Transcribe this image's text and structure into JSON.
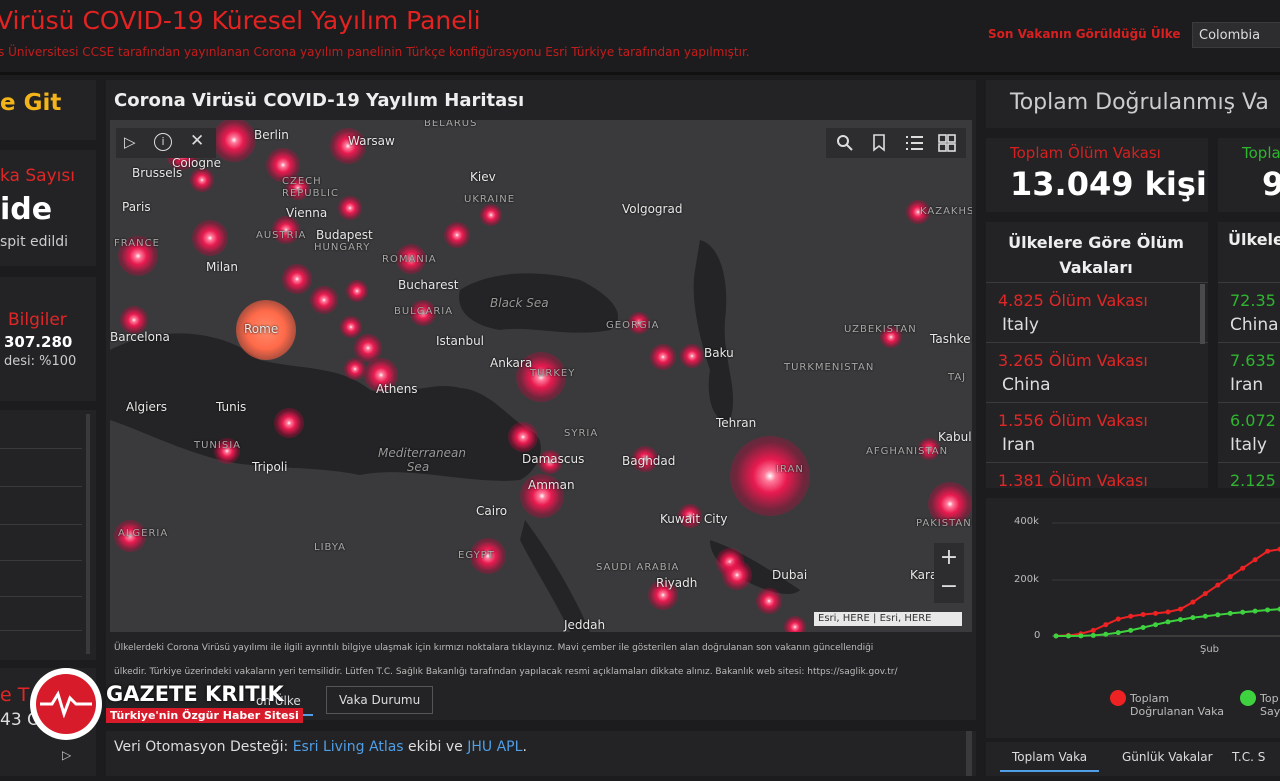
{
  "header": {
    "title": "Virüsü COVID-19 Küresel Yayılım Paneli",
    "subtitle": "s Üniversitesi CCSE tarafından yayınlanan Corona yayılım panelinin Türkçe konfigürasyonu Esri Türkiye tarafından yapılmıştır.",
    "last_case_label": "Son Vakanın Görüldüğü Ülke",
    "last_case_country": "Colombia"
  },
  "left": {
    "goto_label": "e Git",
    "case_count_label": "ka Sayısı",
    "case_count_value": "ide",
    "case_count_note": "spit edildi",
    "info_label": "Bilgiler",
    "info_value": "307.280",
    "info_note": "desi: %100",
    "bottom_label": "e T",
    "bottom_value": "43 O"
  },
  "map": {
    "title": "Corona Virüsü COVID-19 Yayılım Haritası",
    "attribution": "Esri, HERE | Esri, HERE",
    "note_line1": "Ülkelerdeki Corona Virüsü yayılımı ile ilgili ayrıntılı bilgiye ulaşmak için kırmızı noktalara tıklayınız. Mavi çember ile gösterilen alan doğrulanan son vakanın güncellendiği",
    "note_line2": "ülkedir. Türkiye üzerindeki vakaların yeri temsilidir. Lütfen T.C. Sağlık Bakanlığı tarafından yapılacak resmi açıklamaları dikkate alınız. Bakanlık web sitesi: https://saglik.gov.tr/",
    "labels": {
      "berlin": "Berlin",
      "warsaw": "Warsaw",
      "belarus": "BELARUS",
      "cologne": "Cologne",
      "brussels": "Brussels",
      "czech": "CZECH REPUBLIC",
      "kiev": "Kiev",
      "ukraine": "UKRAINE",
      "paris": "Paris",
      "vienna": "Vienna",
      "budapest": "Budapest",
      "hungary": "HUNGARY",
      "austria": "AUSTRIA",
      "france": "FRANCE",
      "volgograd": "Volgograd",
      "kazakhstan": "KAZAKHS",
      "romania": "ROMANIA",
      "milan": "Milan",
      "bucharest": "Bucharest",
      "bulgaria": "BULGARIA",
      "blacksea": "Black Sea",
      "barcelona": "Barcelona",
      "rome": "Rome",
      "georgia": "GEORGIA",
      "uzbekistan": "UZBEKISTAN",
      "tashkent": "Tashke",
      "istanbul": "Istanbul",
      "baku": "Baku",
      "ankara": "Ankara",
      "turkey": "TURKEY",
      "turkmenistan": "TURKMENISTAN",
      "athens": "Athens",
      "algiers": "Algiers",
      "tunis": "Tunis",
      "taj": "TAJ",
      "tunisia": "TUNISIA",
      "tehran": "Tehran",
      "syria": "SYRIA",
      "kabul": "Kabul",
      "tripoli": "Tripoli",
      "medsea": "Mediterranean Sea",
      "damascus": "Damascus",
      "baghdad": "Baghdad",
      "iran": "IRAN",
      "afghanistan": "AFGHANISTAN",
      "amman": "Amman",
      "algeria": "ALGERIA",
      "cairo": "Cairo",
      "kuwait": "Kuwait City",
      "pakistan": "PAKISTAN",
      "libya": "LIBYA",
      "egypt": "EGYPT",
      "saudi": "SAUDI ARABIA",
      "riyadh": "Riyadh",
      "dubai": "Dubai",
      "karachi": "Kara",
      "jeddah": "Jeddah"
    },
    "tabs": {
      "country": "on Ülke",
      "status": "Vaka Durumu"
    }
  },
  "footer": {
    "prefix": "Veri Otomasyon Desteği: ",
    "link1": "Esri Living Atlas",
    "middle": " ekibi ve ",
    "link2": "JHU APL",
    "suffix": "."
  },
  "right": {
    "total_title": "Toplam Doğrulanmış Va",
    "death_label": "Toplam Ölüm Vakası",
    "death_value": "13.049 kişi",
    "recovered_label": "Topla",
    "recovered_value": "9",
    "death_list_title": "Ülkelere Göre Ölüm Vakaları",
    "death_rows": [
      {
        "value": "4.825 Ölüm Vakası",
        "country": "Italy"
      },
      {
        "value": "3.265 Ölüm Vakası",
        "country": "China"
      },
      {
        "value": "1.556 Ölüm Vakası",
        "country": "Iran"
      },
      {
        "value": "1.381 Ölüm Vakası",
        "country": ""
      }
    ],
    "recovered_list_title": "Ülkele",
    "recovered_rows": [
      {
        "value": "72.35",
        "country": "China"
      },
      {
        "value": "7.635",
        "country": "Iran"
      },
      {
        "value": "6.072",
        "country": "Italy"
      },
      {
        "value": "2.125",
        "country": ""
      }
    ],
    "chart_tabs": [
      "Toplam Vaka",
      "Günlük Vakalar",
      "T.C. S"
    ]
  },
  "chart_data": {
    "type": "line",
    "x_tick_label": "Şub",
    "y_ticks": [
      "400k",
      "200k",
      "0"
    ],
    "ylim": [
      0,
      400000
    ],
    "series": [
      {
        "name": "Toplam Doğrulanan Vaka",
        "color": "#ee2222",
        "values": [
          500,
          2000,
          8000,
          20000,
          40000,
          60000,
          70000,
          76000,
          80000,
          85000,
          95000,
          120000,
          150000,
          180000,
          210000,
          240000,
          270000,
          300000,
          307280
        ]
      },
      {
        "name": "Top Say",
        "color": "#3ed33e",
        "values": [
          0,
          100,
          500,
          2000,
          6000,
          12000,
          20000,
          30000,
          40000,
          50000,
          58000,
          65000,
          70000,
          75000,
          80000,
          84000,
          88000,
          92000,
          95000
        ]
      }
    ],
    "legend": [
      {
        "label_line1": "Toplam",
        "label_line2": "Doğrulanan Vaka",
        "color": "#ee2222"
      },
      {
        "label_line1": "Top",
        "label_line2": "Say",
        "color": "#3ed33e"
      }
    ]
  },
  "watermark": {
    "brand": "GAZETE KRITIK",
    "tagline": "Türkiye'nin Özgür Haber Sitesi"
  }
}
